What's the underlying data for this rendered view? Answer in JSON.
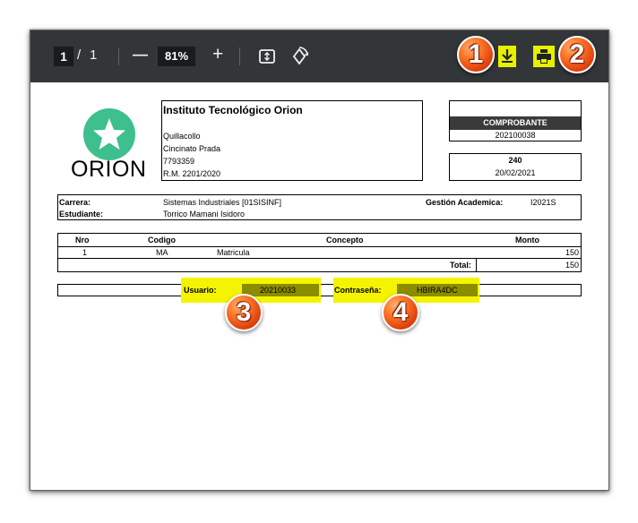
{
  "toolbar": {
    "page_current": "1",
    "page_separator": "/",
    "page_total": "1",
    "zoom_out_symbol": "—",
    "zoom_level": "81%",
    "zoom_in_symbol": "+",
    "icons": [
      "fit-page-icon",
      "rotate-icon",
      "download-icon",
      "print-icon"
    ],
    "highlight_color": "#e8f000",
    "bar_color": "#323639"
  },
  "badges": {
    "b1": "1",
    "b2": "2",
    "b3": "3",
    "b4": "4"
  },
  "document": {
    "logo_text": "ORION",
    "logo_color": "#3dbf8e",
    "institution": {
      "name": "Instituto Tecnológico Orion",
      "city": "Quillacollo",
      "street": "Cincinato Prada",
      "phone": "7793359",
      "rm": "R.M. 2201/2020"
    },
    "receipt": {
      "header": "COMPROBANTE",
      "number": "202100038",
      "code": "240",
      "date": "20/02/2021"
    },
    "info": {
      "carrera_label": "Carrera:",
      "carrera_value": "Sistemas Industriales [01SISINF]",
      "gestion_label": "Gestión Academica:",
      "gestion_value": "I2021S",
      "estudiante_label": "Estudiante:",
      "estudiante_value": "Torrico  Mamani Isidoro"
    },
    "table": {
      "headers": [
        "Nro",
        "Codigo",
        "Concepto",
        "Monto"
      ],
      "rows": [
        {
          "nro": "1",
          "codigo": "MA",
          "concepto": "Matricula",
          "monto": "150"
        }
      ],
      "total_label": "Total:",
      "total_value": "150"
    },
    "credentials": {
      "usuario_label": "Usuario:",
      "usuario_value": "20210033",
      "contrasena_label": "Contraseña:",
      "contrasena_value": "HBIRA4DC"
    }
  }
}
